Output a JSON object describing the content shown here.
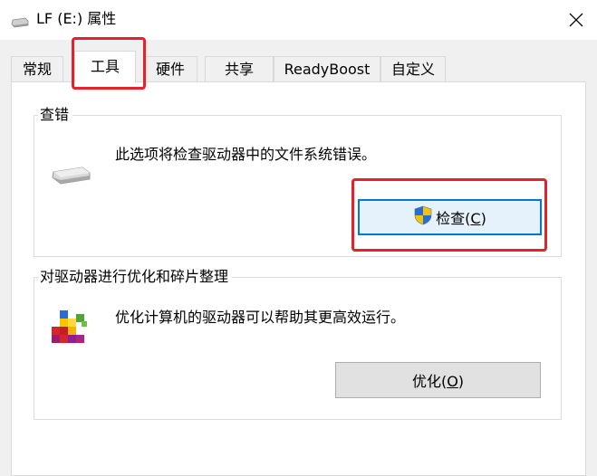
{
  "window": {
    "title": "LF (E:) 属性"
  },
  "tabs": [
    {
      "label": "常规",
      "active": false
    },
    {
      "label": "工具",
      "active": true
    },
    {
      "label": "硬件",
      "active": false
    },
    {
      "label": "共享",
      "active": false
    },
    {
      "label": "ReadyBoost",
      "active": false
    },
    {
      "label": "自定义",
      "active": false
    }
  ],
  "error_check": {
    "title": "查错",
    "description": "此选项将检查驱动器中的文件系统错误。",
    "button_text": "检查(",
    "button_key": "C",
    "button_close": ")"
  },
  "optimize": {
    "title": "对驱动器进行优化和碎片整理",
    "description": "优化计算机的驱动器可以帮助其更高效运行。",
    "button_text": "优化(",
    "button_key": "O",
    "button_close": ")"
  },
  "colors": {
    "highlight": "#e8202a",
    "focus_border": "#0078d7"
  },
  "icons": {
    "title": "drive-icon",
    "close": "close-icon",
    "error_check": "drive-icon",
    "shield": "uac-shield-icon",
    "optimize": "defrag-icon"
  }
}
